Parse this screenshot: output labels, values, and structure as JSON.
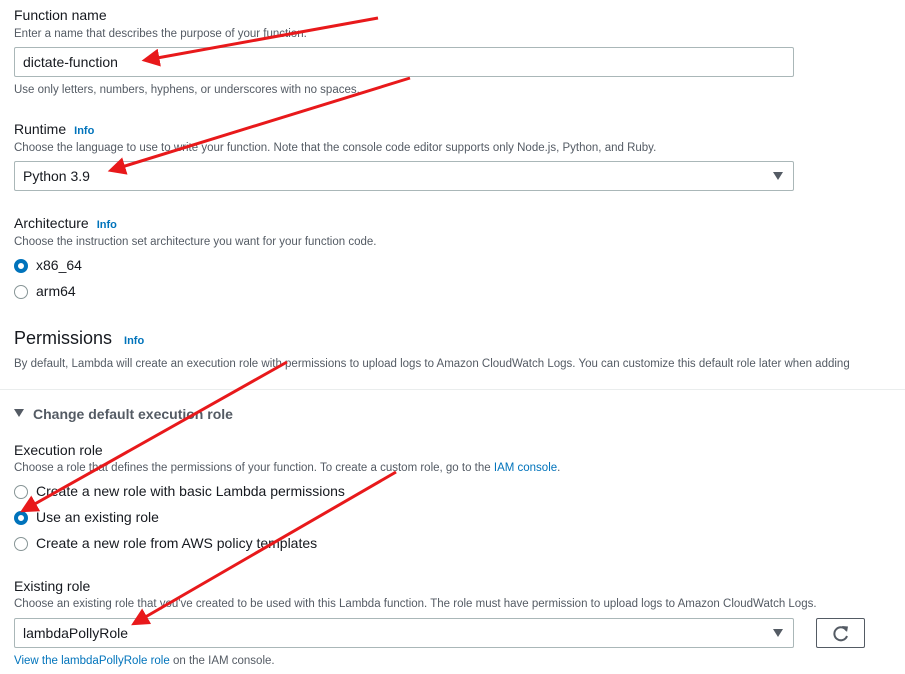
{
  "function_name": {
    "label": "Function name",
    "description": "Enter a name that describes the purpose of your function.",
    "value": "dictate-function",
    "hint": "Use only letters, numbers, hyphens, or underscores with no spaces."
  },
  "runtime": {
    "label": "Runtime",
    "info": "Info",
    "description": "Choose the language to use to write your function. Note that the console code editor supports only Node.js, Python, and Ruby.",
    "value": "Python 3.9"
  },
  "architecture": {
    "label": "Architecture",
    "info": "Info",
    "description": "Choose the instruction set architecture you want for your function code.",
    "options": [
      "x86_64",
      "arm64"
    ],
    "selected": "x86_64"
  },
  "permissions": {
    "heading": "Permissions",
    "info": "Info",
    "description": "By default, Lambda will create an execution role with permissions to upload logs to Amazon CloudWatch Logs. You can customize this default role later when adding"
  },
  "change_role": {
    "label": "Change default execution role"
  },
  "execution_role": {
    "label": "Execution role",
    "description": "Choose a role that defines the permissions of your function. To create a custom role, go to the",
    "link": "IAM console",
    "description_end": ".",
    "options": [
      "Create a new role with basic Lambda permissions",
      "Use an existing role",
      "Create a new role from AWS policy templates"
    ],
    "selected": "Use an existing role"
  },
  "existing_role": {
    "label": "Existing role",
    "description": "Choose an existing role that you've created to be used with this Lambda function. The role must have permission to upload logs to Amazon CloudWatch Logs.",
    "value": "lambdaPollyRole",
    "view_link": "View the lambdaPollyRole role",
    "view_suffix": " on the IAM console."
  },
  "colors": {
    "accent": "#0073bb",
    "annotation_arrow": "#e8191b"
  },
  "icons": [
    "caret-down-icon",
    "refresh-icon",
    "expand-triangle-icon"
  ]
}
